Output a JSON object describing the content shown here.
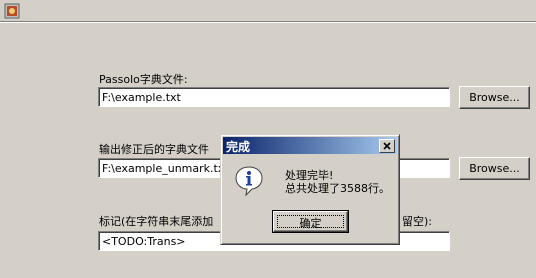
{
  "window": {
    "icon": "app-icon"
  },
  "fields": {
    "dict_label": "Passolo字典文件:",
    "dict_value": "F:\\example.txt",
    "output_label_left": "输出修正后的字典文件",
    "output_value": "F:\\example_unmark.txt",
    "mark_label_left": "标记(在字符串末尾添加",
    "mark_label_right": "留空):",
    "mark_value": "<TODO:Trans>"
  },
  "buttons": {
    "browse": "Browse..."
  },
  "dialog": {
    "title": "完成",
    "icon": "info-icon",
    "close_icon": "close-icon",
    "line1": "处理完毕!",
    "line2": "总共处理了3588行。",
    "ok": "确定"
  }
}
